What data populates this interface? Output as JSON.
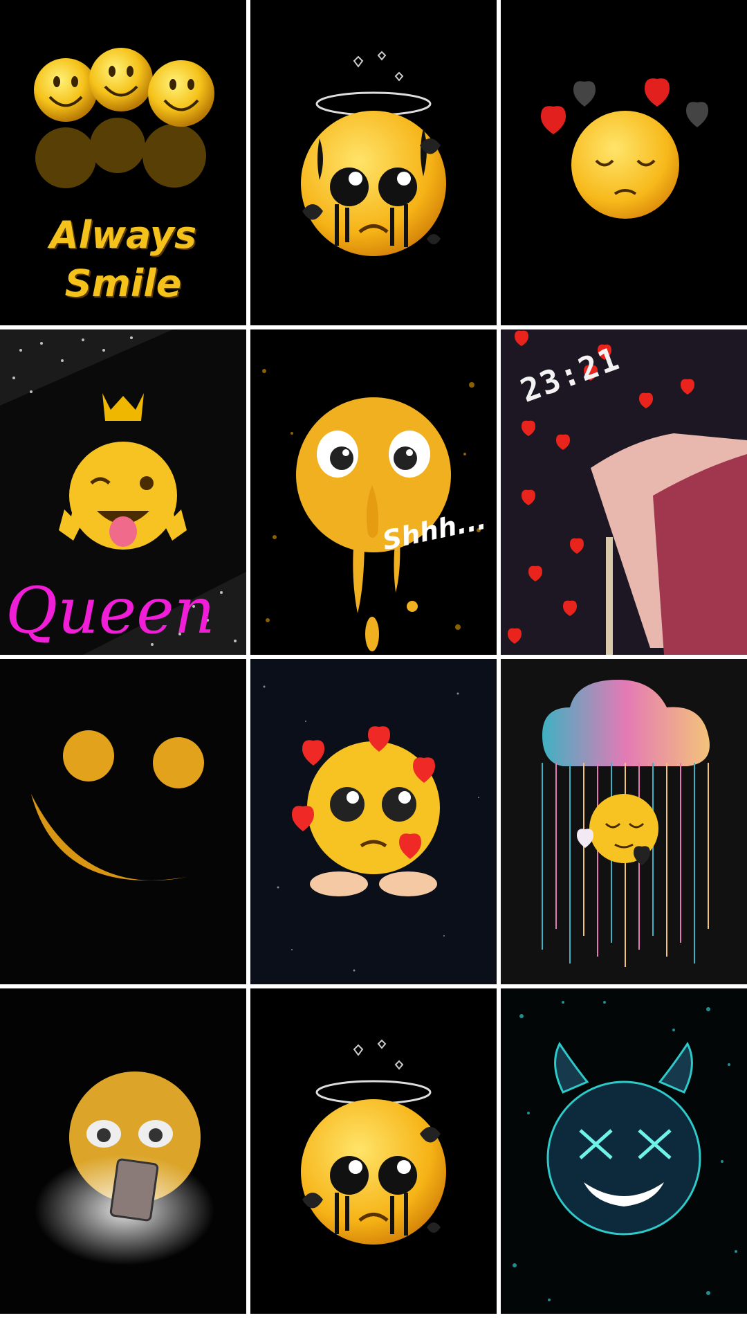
{
  "gallery": {
    "tiles": [
      {
        "id": "always-smile",
        "line1": "Always",
        "line2": "Smile"
      },
      {
        "id": "crying-halo"
      },
      {
        "id": "sad-hearts"
      },
      {
        "id": "queen",
        "caption": "Queen"
      },
      {
        "id": "shhh",
        "caption": "Shhh..."
      },
      {
        "id": "hand-hearts",
        "time": "23:21"
      },
      {
        "id": "minimal-smile"
      },
      {
        "id": "pleading-broken-hearts"
      },
      {
        "id": "rain-cloud"
      },
      {
        "id": "phone-crying"
      },
      {
        "id": "crying-halo-2"
      },
      {
        "id": "blue-devil"
      }
    ]
  },
  "colors": {
    "background": "#000000",
    "separator": "#ffffff",
    "emoji_yellow": "#f7c322",
    "queen_pink": "#f01ed7",
    "devil_teal": "#2ec9c9"
  }
}
